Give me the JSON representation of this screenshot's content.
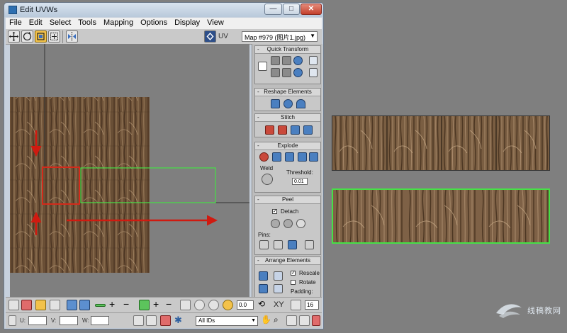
{
  "window": {
    "title": "Edit UVWs",
    "min_label": "—",
    "max_label": "□",
    "close_label": "✕"
  },
  "menu": [
    "File",
    "Edit",
    "Select",
    "Tools",
    "Mapping",
    "Options",
    "Display",
    "View"
  ],
  "toolbar": {
    "uv_label": "UV",
    "map_select": "Map #979 (图片1.jpg)"
  },
  "panel": {
    "quick_transform": "Quick Transform",
    "reshape_elements": "Reshape Elements",
    "stitch": "Stitch",
    "explode": "Explode",
    "weld": "Weld",
    "threshold_label": "Threshold:",
    "threshold_value": "0.01",
    "peel": "Peel",
    "detach": "Detach",
    "pins": "Pins:",
    "arrange_elements": "Arrange Elements",
    "rescale": "Rescale",
    "rotate": "Rotate",
    "padding": "Padding:"
  },
  "bottom": {
    "u_label": "U:",
    "v_label": "V:",
    "w_label": "W:",
    "angle_value": "0.0",
    "xy_label": "XY",
    "ids_select": "All IDs",
    "zoom_value": "16"
  },
  "watermark": "线稿教网",
  "colors": {
    "selection_red": "#d42a1a",
    "element_green": "#46e046",
    "arrow_red": "#d01a10"
  }
}
